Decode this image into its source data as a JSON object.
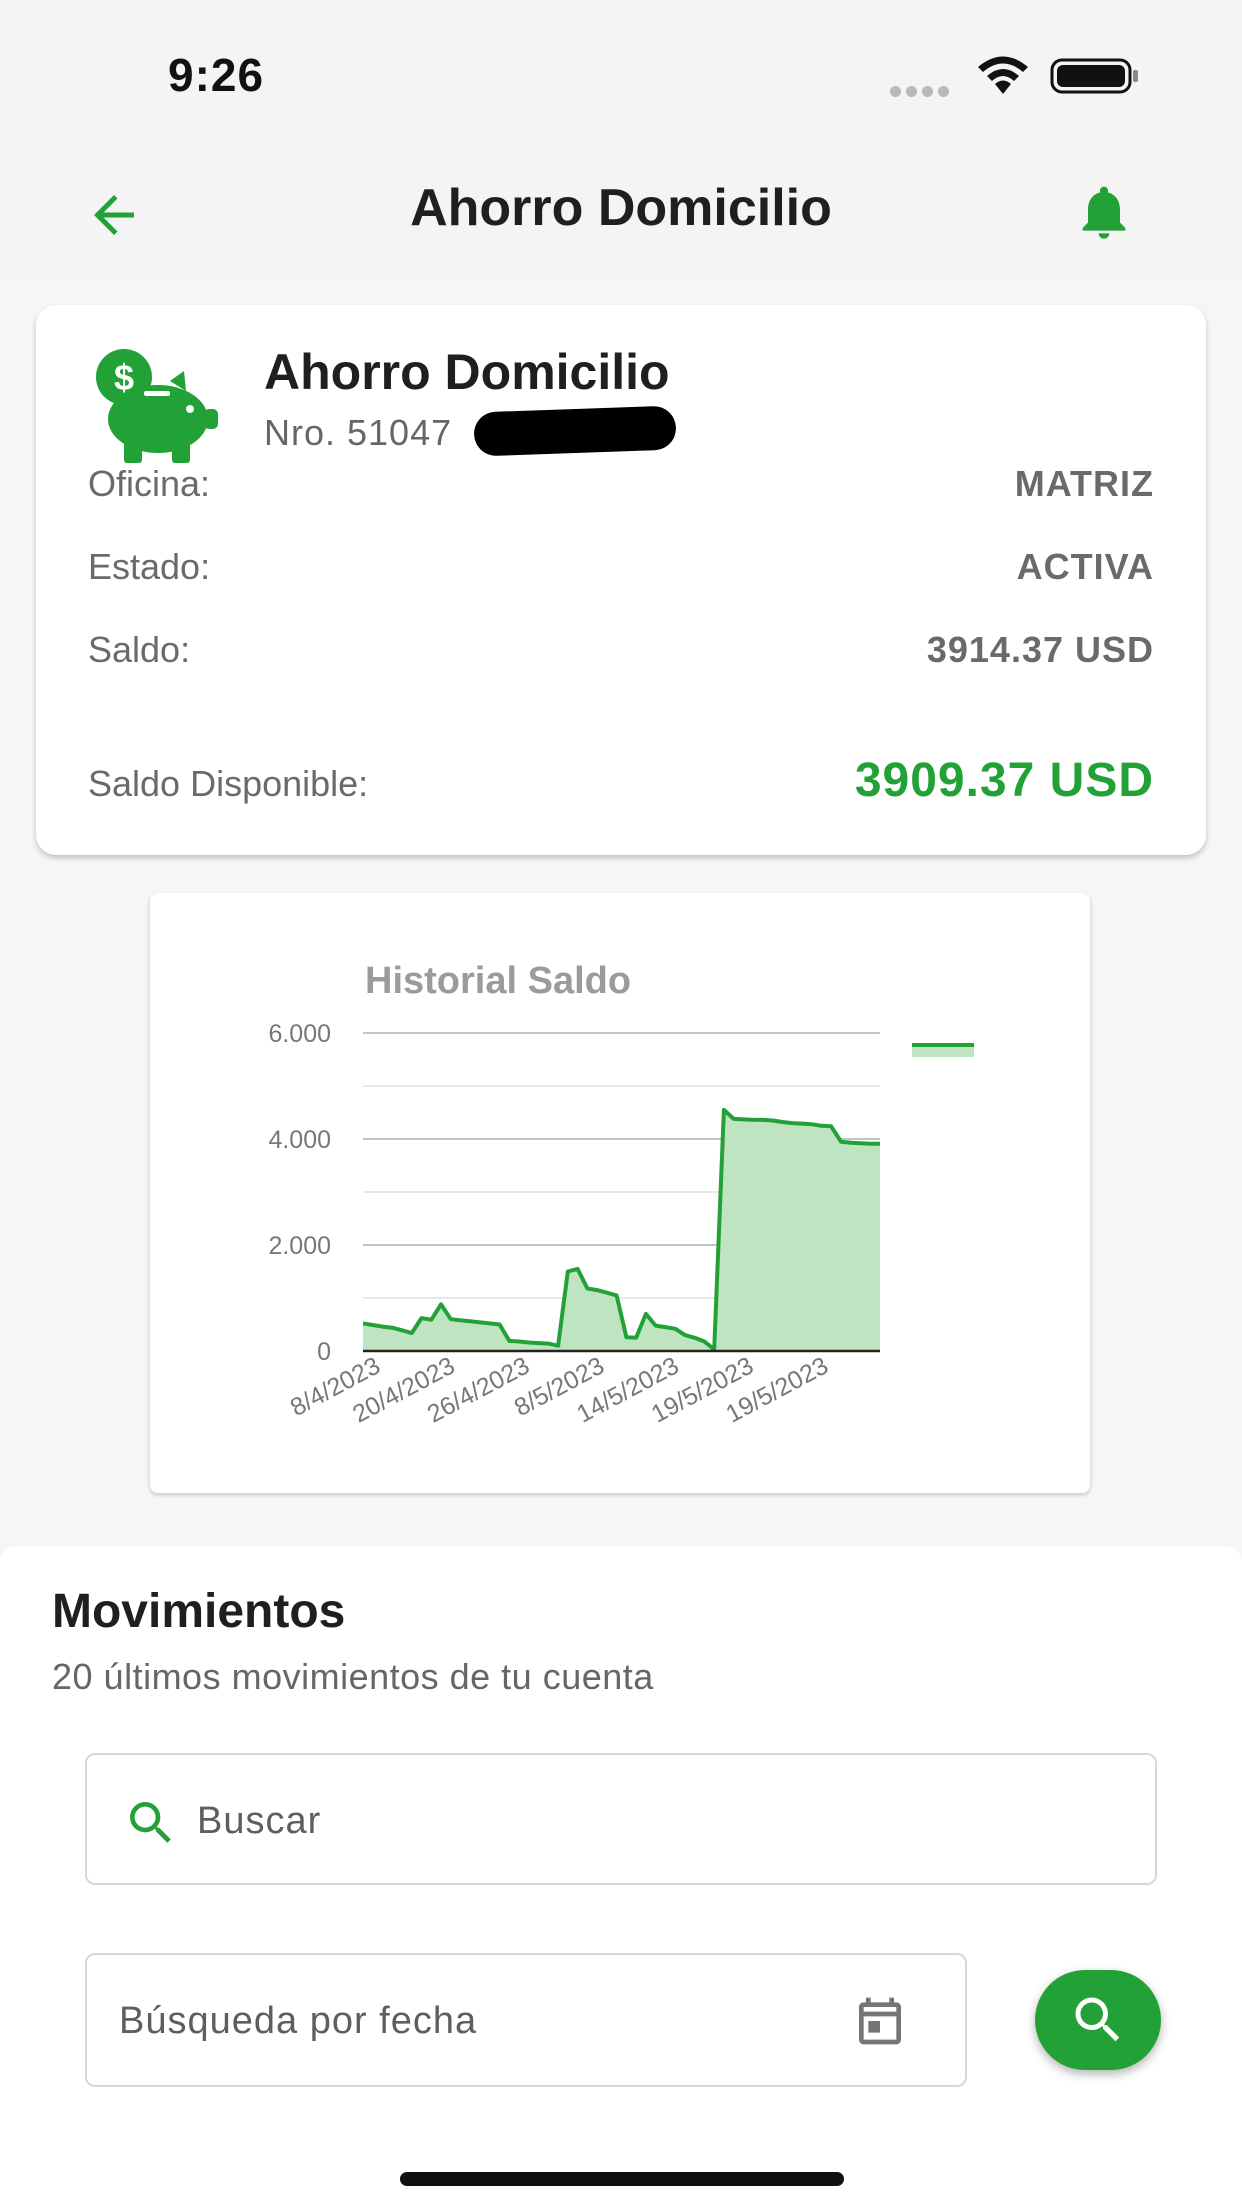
{
  "status_bar": {
    "time": "9:26"
  },
  "header": {
    "title": "Ahorro Domicilio"
  },
  "account": {
    "title": "Ahorro Domicilio",
    "number": "Nro. 51047",
    "rows": [
      {
        "label": "Oficina:",
        "value": "MATRIZ"
      },
      {
        "label": "Estado:",
        "value": "ACTIVA"
      },
      {
        "label": "Saldo:",
        "value": "3914.37 USD"
      }
    ],
    "available_label": "Saldo Disponible:",
    "available_value": "3909.37 USD"
  },
  "chart_data": {
    "type": "area",
    "title": "Historial Saldo",
    "xlabel": "",
    "ylabel": "",
    "ylim": [
      0,
      6000
    ],
    "y_ticks": [
      "0",
      "2.000",
      "4.000",
      "6.000"
    ],
    "x_tick_labels": [
      "8/4/2023",
      "20/4/2023",
      "26/4/2023",
      "8/5/2023",
      "14/5/2023",
      "19/5/2023",
      "19/5/2023"
    ],
    "grid": true,
    "legend": "top-right",
    "colors": {
      "line": "#22a137",
      "fill": "#bfe4c2"
    },
    "values": [
      520,
      490,
      460,
      440,
      390,
      340,
      620,
      590,
      880,
      600,
      580,
      560,
      540,
      520,
      500,
      190,
      180,
      160,
      150,
      140,
      100,
      1500,
      1550,
      1180,
      1150,
      1100,
      1050,
      260,
      250,
      700,
      480,
      450,
      420,
      300,
      250,
      180,
      30,
      4550,
      4380,
      4370,
      4360,
      4360,
      4350,
      4320,
      4300,
      4290,
      4280,
      4250,
      4240,
      3950,
      3930,
      3920,
      3910,
      3910
    ]
  },
  "movements": {
    "title": "Movimientos",
    "subtitle": "20 últimos movimientos de tu cuenta",
    "search_placeholder": "Buscar",
    "date_placeholder": "Búsqueda por fecha"
  }
}
